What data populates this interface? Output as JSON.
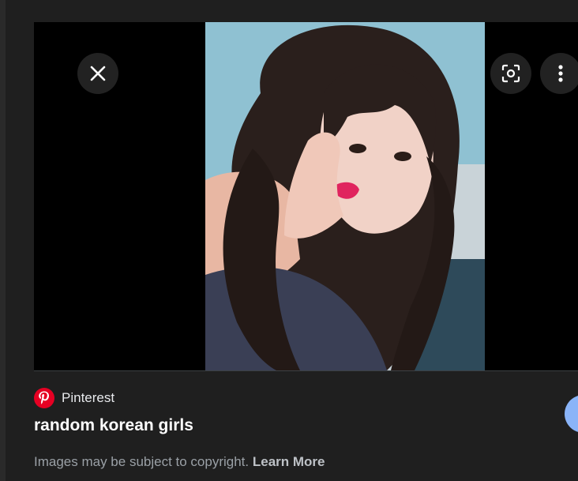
{
  "viewer": {
    "close_icon": "close-icon",
    "lens_icon": "lens-icon",
    "more_icon": "more-vert-icon",
    "share_icon": "share-icon"
  },
  "source": {
    "name": "Pinterest",
    "logo_icon": "pinterest-logo",
    "brand_color": "#e60023"
  },
  "title": "random korean girls",
  "copyright": {
    "text": "Images may be subject to copyright.",
    "link_label": "Learn More"
  },
  "colors": {
    "background": "#1f1f1f",
    "accent": "#8ab4f8"
  }
}
